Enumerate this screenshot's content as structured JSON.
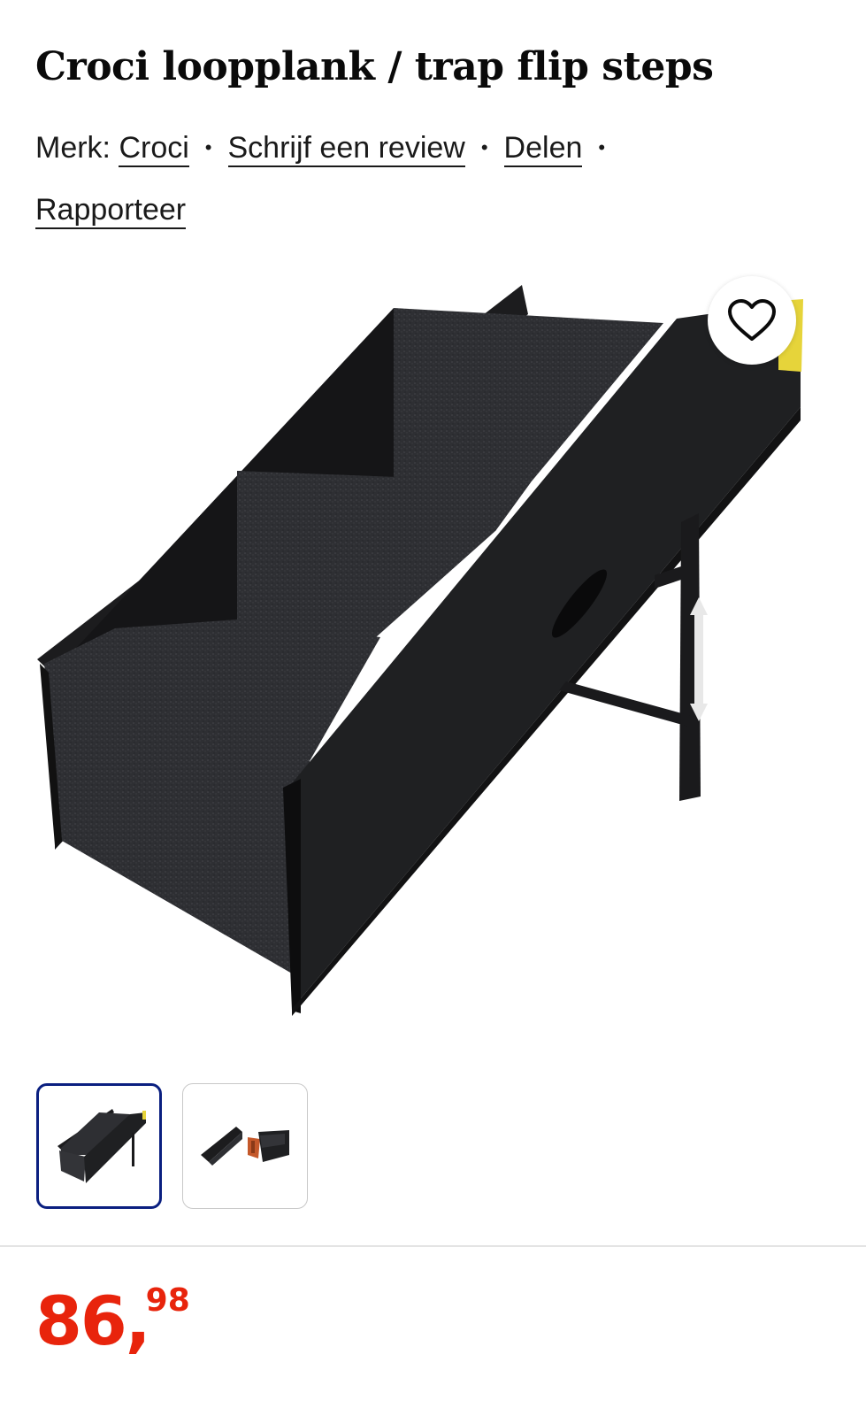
{
  "product": {
    "title": "Croci loopplank / trap flip steps",
    "brand_label": "Merk:",
    "brand_name": "Croci",
    "write_review": "Schrijf een review",
    "share": "Delen",
    "report": "Rapporteer",
    "separator": "•"
  },
  "gallery": {
    "main_image": "dog-stairs-ramp-photo",
    "wishlist_icon": "heart-icon",
    "thumbnails": [
      {
        "image": "stairs-thumbnail",
        "selected": true
      },
      {
        "image": "stairs-folded-thumbnail",
        "selected": false
      }
    ]
  },
  "price": {
    "whole": "86,",
    "decimals": "98"
  },
  "colors": {
    "price": "#e8240c",
    "thumbnail_selected_border": "#0a1f80",
    "text": "#0a0a0a"
  }
}
